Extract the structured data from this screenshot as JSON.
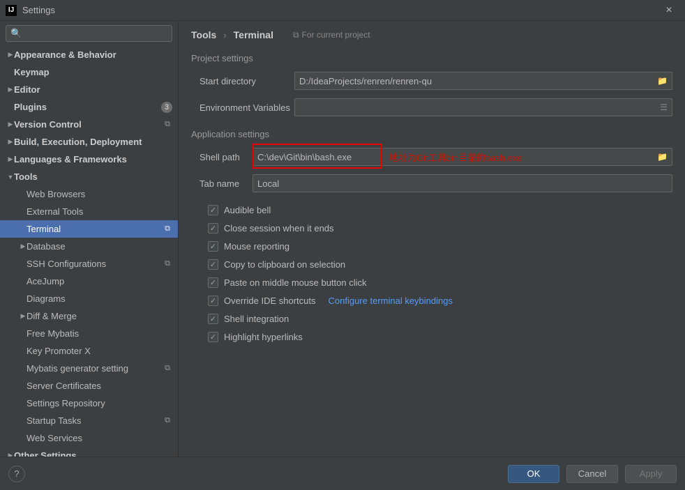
{
  "window": {
    "title": "Settings"
  },
  "search": {
    "placeholder": ""
  },
  "sidebar": {
    "items": [
      {
        "label": "Appearance & Behavior",
        "bold": true,
        "expandable": true,
        "expanded": false,
        "indent": 0
      },
      {
        "label": "Keymap",
        "bold": true,
        "indent": 0
      },
      {
        "label": "Editor",
        "bold": true,
        "expandable": true,
        "expanded": false,
        "indent": 0
      },
      {
        "label": "Plugins",
        "bold": true,
        "indent": 0,
        "badgeNum": "3"
      },
      {
        "label": "Version Control",
        "bold": true,
        "expandable": true,
        "expanded": false,
        "indent": 0,
        "badgeIcon": true
      },
      {
        "label": "Build, Execution, Deployment",
        "bold": true,
        "expandable": true,
        "expanded": false,
        "indent": 0
      },
      {
        "label": "Languages & Frameworks",
        "bold": true,
        "expandable": true,
        "expanded": false,
        "indent": 0
      },
      {
        "label": "Tools",
        "bold": true,
        "expandable": true,
        "expanded": true,
        "indent": 0
      },
      {
        "label": "Web Browsers",
        "indent": 1
      },
      {
        "label": "External Tools",
        "indent": 1
      },
      {
        "label": "Terminal",
        "indent": 1,
        "selected": true,
        "badgeIcon": true
      },
      {
        "label": "Database",
        "expandable": true,
        "expanded": false,
        "indent": 1
      },
      {
        "label": "SSH Configurations",
        "indent": 1,
        "badgeIcon": true
      },
      {
        "label": "AceJump",
        "indent": 1
      },
      {
        "label": "Diagrams",
        "indent": 1
      },
      {
        "label": "Diff & Merge",
        "expandable": true,
        "expanded": false,
        "indent": 1
      },
      {
        "label": "Free Mybatis",
        "indent": 1
      },
      {
        "label": "Key Promoter X",
        "indent": 1
      },
      {
        "label": "Mybatis generator setting",
        "indent": 1,
        "badgeIcon": true
      },
      {
        "label": "Server Certificates",
        "indent": 1
      },
      {
        "label": "Settings Repository",
        "indent": 1
      },
      {
        "label": "Startup Tasks",
        "indent": 1,
        "badgeIcon": true
      },
      {
        "label": "Web Services",
        "indent": 1
      },
      {
        "label": "Other Settings",
        "bold": true,
        "expandable": true,
        "expanded": false,
        "indent": 0
      }
    ]
  },
  "breadcrumb": {
    "a": "Tools",
    "b": "Terminal",
    "forProject": "For current project"
  },
  "sections": {
    "project": "Project settings",
    "application": "Application settings"
  },
  "project": {
    "startDirLabel": "Start directory",
    "startDir": "D:/IdeaProjects/renren/renren-qu",
    "envVarsLabel": "Environment Variables",
    "envVars": ""
  },
  "app": {
    "shellPathLabel": "Shell path",
    "shellPath": "C:\\dev\\Git\\bin\\bash.exe",
    "tabNameLabel": "Tab name",
    "tabName": "Local",
    "checks": [
      {
        "label": "Audible bell"
      },
      {
        "label": "Close session when it ends"
      },
      {
        "label": "Mouse reporting"
      },
      {
        "label": "Copy to clipboard on selection"
      },
      {
        "label": "Paste on middle mouse button click"
      },
      {
        "label": "Override IDE shortcuts",
        "link": "Configure terminal keybindings"
      },
      {
        "label": "Shell integration"
      },
      {
        "label": "Highlight hyperlinks"
      }
    ]
  },
  "annotation": {
    "text": "地址为Git工具bin目录的bash.exe"
  },
  "footer": {
    "ok": "OK",
    "cancel": "Cancel",
    "apply": "Apply"
  }
}
